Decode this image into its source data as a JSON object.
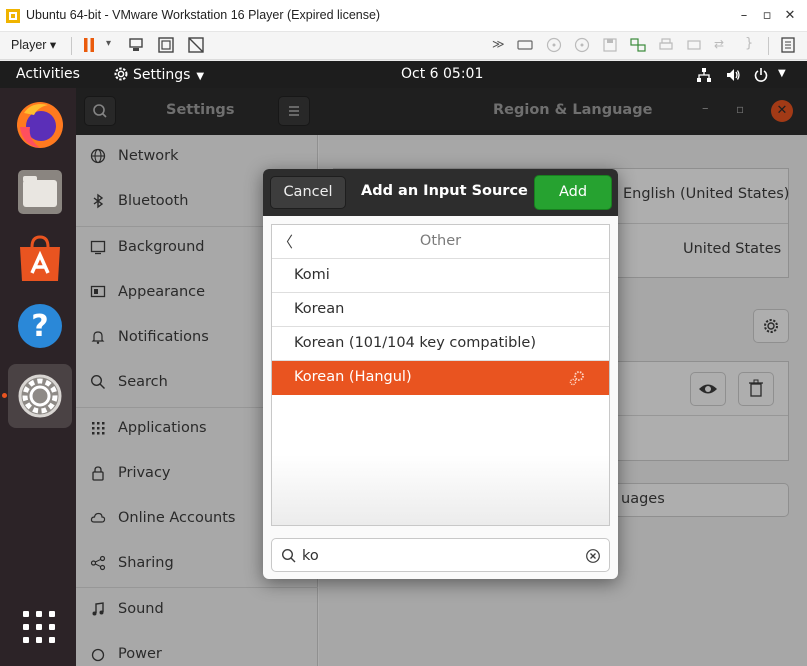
{
  "vmware": {
    "title": "Ubuntu 64-bit - VMware Workstation 16 Player (Expired license)",
    "player_menu": "Player"
  },
  "topbar": {
    "activities": "Activities",
    "app_menu": "Settings",
    "clock": "Oct 6  05:01"
  },
  "dock": {
    "items": [
      "firefox-icon",
      "files-icon",
      "software-icon",
      "help-icon",
      "settings-icon",
      "app-grid-icon"
    ]
  },
  "settings": {
    "sidebar_title": "Settings",
    "panel_title": "Region & Language",
    "nav": [
      {
        "label": "Network",
        "icon": "network-icon"
      },
      {
        "label": "Bluetooth",
        "icon": "bluetooth-icon"
      },
      {
        "label": "Background",
        "icon": "background-icon"
      },
      {
        "label": "Appearance",
        "icon": "appearance-icon"
      },
      {
        "label": "Notifications",
        "icon": "bell-icon"
      },
      {
        "label": "Search",
        "icon": "search-icon"
      },
      {
        "label": "Applications",
        "icon": "applications-icon"
      },
      {
        "label": "Privacy",
        "icon": "lock-icon"
      },
      {
        "label": "Online Accounts",
        "icon": "cloud-icon"
      },
      {
        "label": "Sharing",
        "icon": "share-icon"
      },
      {
        "label": "Sound",
        "icon": "music-icon"
      },
      {
        "label": "Power",
        "icon": "power-icon"
      }
    ],
    "background": {
      "language_value": "English (United States)",
      "formats_value": "United States",
      "manage_fragment": "uages"
    }
  },
  "dialog": {
    "cancel": "Cancel",
    "title": "Add an Input Source",
    "add": "Add",
    "list_header": "Other",
    "items": [
      {
        "label": "Komi",
        "selected": false
      },
      {
        "label": "Korean",
        "selected": false
      },
      {
        "label": "Korean (101/104 key compatible)",
        "selected": false
      },
      {
        "label": "Korean (Hangul)",
        "selected": true
      }
    ],
    "search_value": "ko"
  },
  "colors": {
    "accent": "#e95420",
    "add_green": "#26a230",
    "topbar": "#1d1d1d",
    "dock": "#2c2327"
  }
}
